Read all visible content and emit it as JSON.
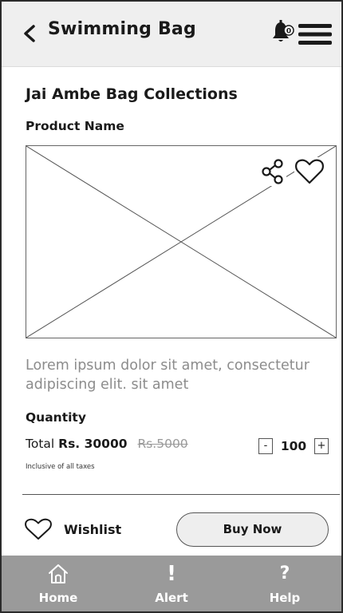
{
  "header": {
    "title": "Swimming Bag",
    "notification_count": "0"
  },
  "product": {
    "brand": "Jai Ambe Bag Collections",
    "name_label": "Product Name",
    "description": "Lorem ipsum dolor sit amet, consectetur adipiscing elit. sit amet"
  },
  "purchase": {
    "quantity_label": "Quantity",
    "total_label": "Total",
    "price": "Rs. 30000",
    "old_price": "Rs.5000",
    "tax_note": "Inclusive of all taxes",
    "decrement": "-",
    "increment": "+",
    "quantity": "100"
  },
  "actions": {
    "wishlist_label": "Wishlist",
    "buy_label": "Buy Now"
  },
  "bottom_nav": {
    "items": [
      {
        "label": "Home",
        "icon": "home-icon"
      },
      {
        "label": "Alert",
        "icon": "alert-icon",
        "glyph": "!"
      },
      {
        "label": "Help",
        "icon": "help-icon",
        "glyph": "?"
      }
    ]
  },
  "colors": {
    "header_bg": "#efefef",
    "nav_bg": "#9a9a9a",
    "button_bg": "#eeeeee",
    "muted_text": "#8c8c8c"
  }
}
